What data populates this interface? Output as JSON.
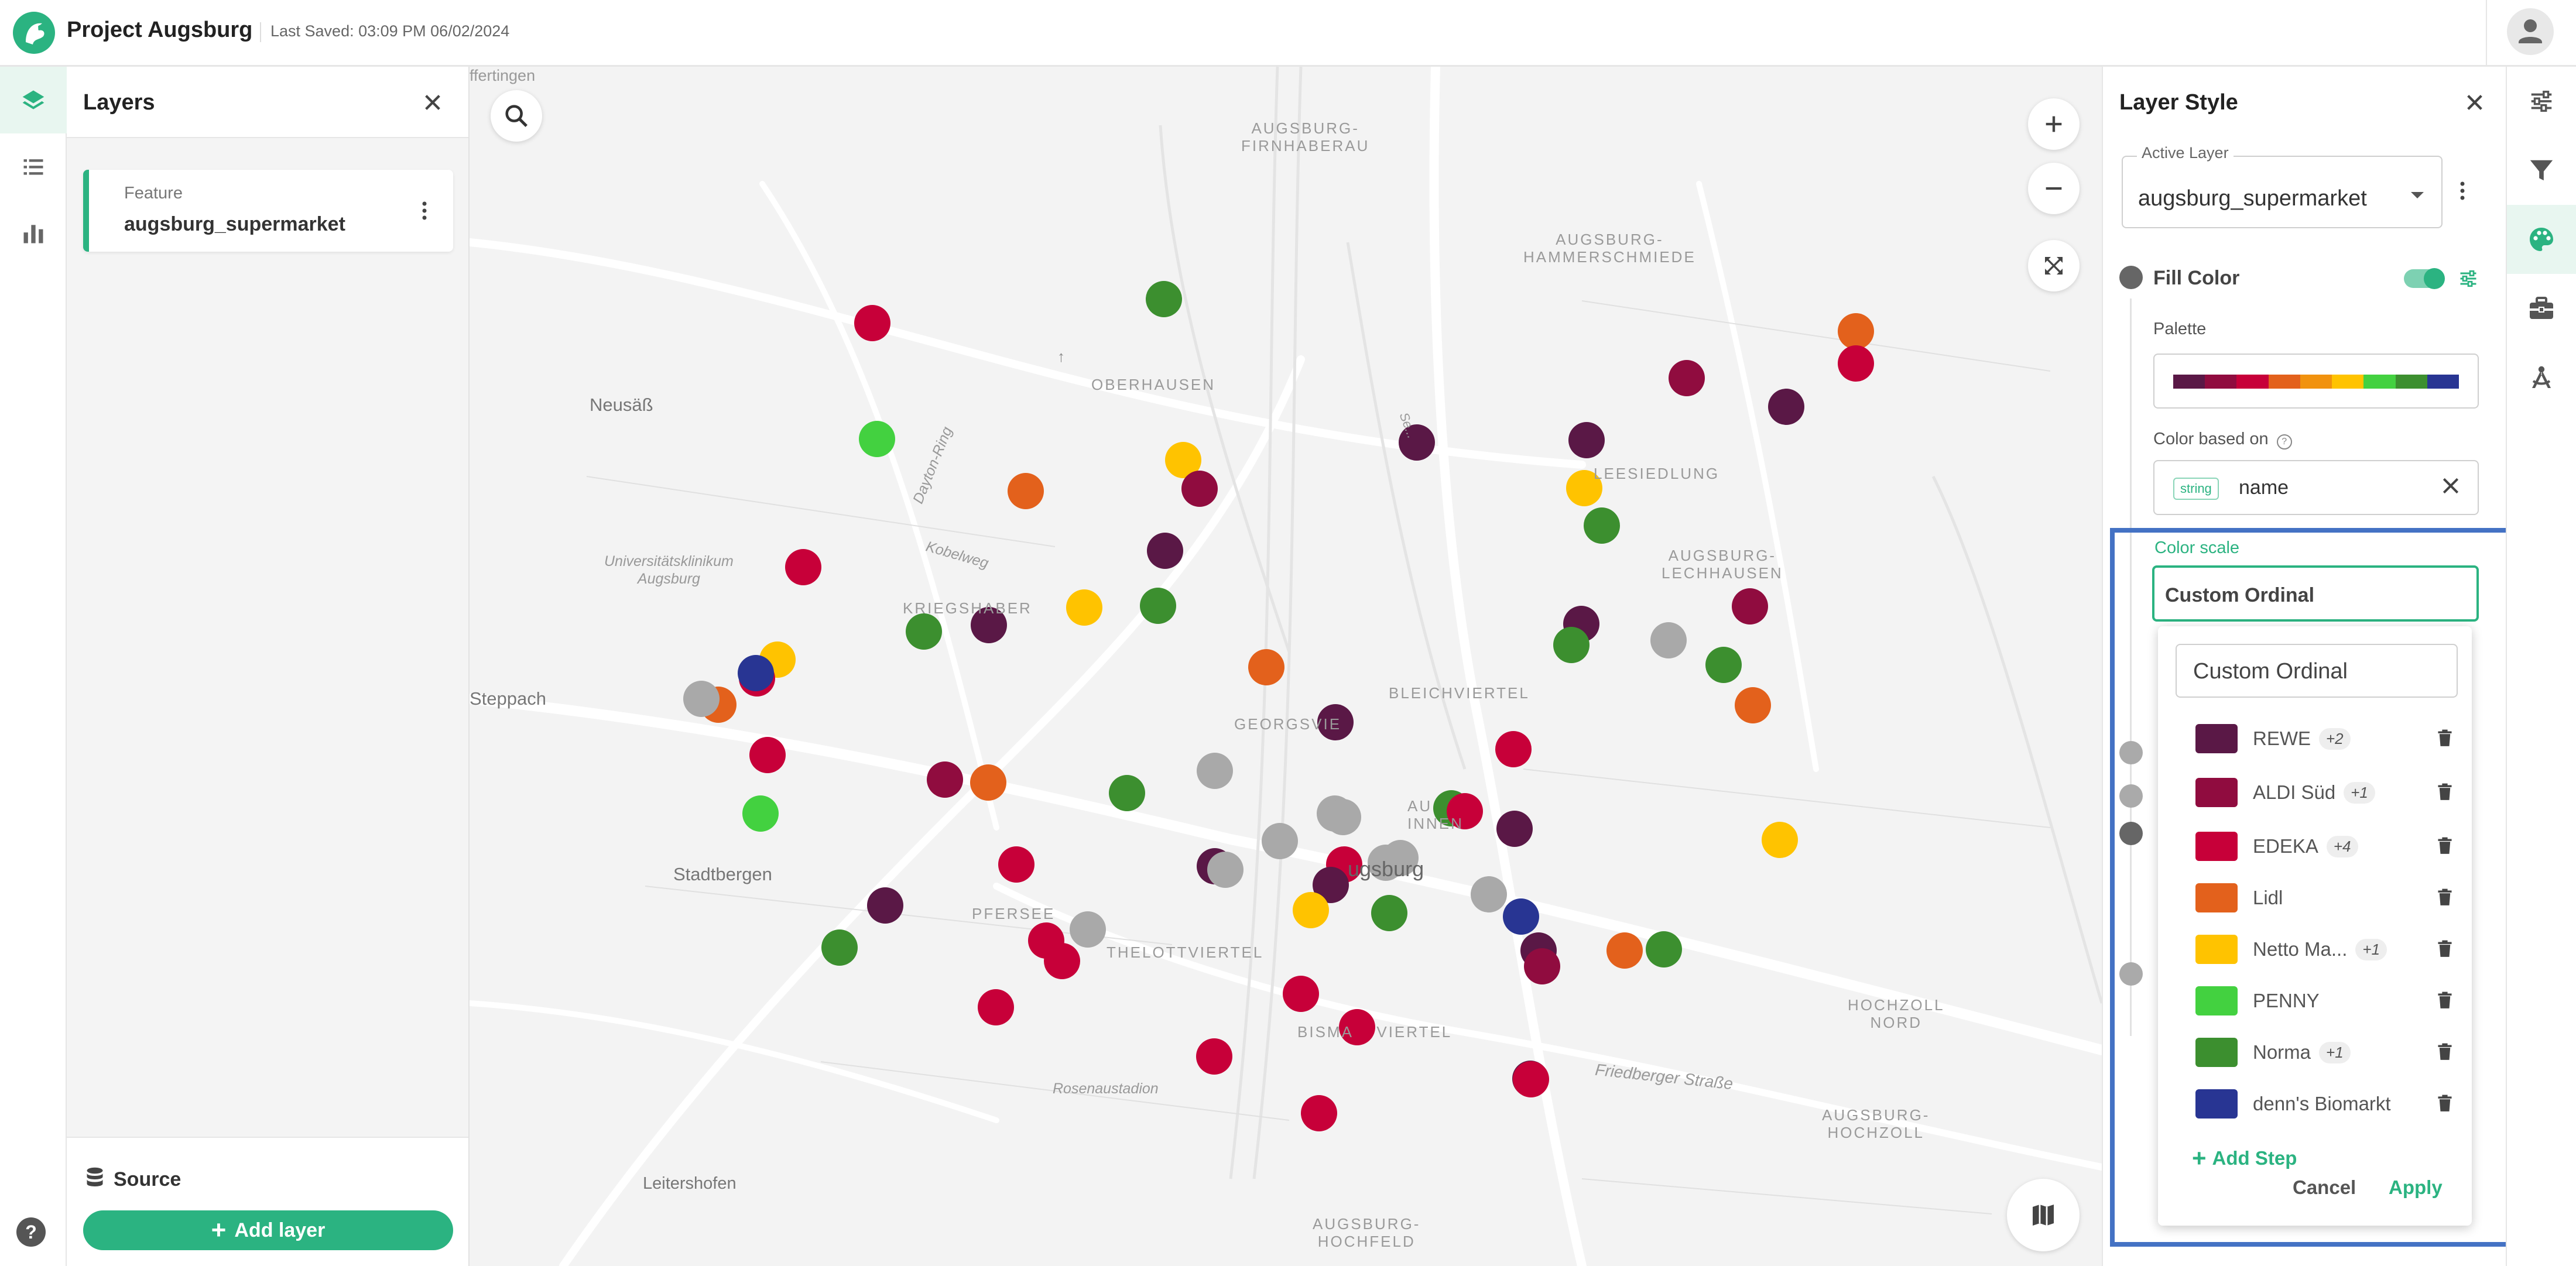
{
  "header": {
    "app_title": "Project Augsburg",
    "last_saved": "Last Saved: 03:09 PM 06/02/2024"
  },
  "left_rail": {
    "items": [
      {
        "icon": "layers-icon",
        "active": true
      },
      {
        "icon": "list-icon",
        "active": false
      },
      {
        "icon": "bar-chart-icon",
        "active": false
      }
    ]
  },
  "layers_panel": {
    "title": "Layers",
    "layer_card": {
      "type": "Feature",
      "name": "augsburg_supermarket"
    },
    "source_label": "Source",
    "add_layer_label": "Add layer"
  },
  "map": {
    "labels": {
      "affingen": "ffertingen",
      "neusass": "Neusäß",
      "steppach": "Steppach",
      "stadtbergen": "Stadtbergen",
      "leitershofen": "Leitershofen",
      "oberhausen": "OBERHAUSEN",
      "firnhaberau": "AUGSBURG-\nFIRNHABERAU",
      "hammerschmiede": "AUGSBURG-\nHAMMERSCHMIEDE",
      "lechhausen": "AUGSBURG-\nLECHHAUSEN",
      "kriegshaber": "KRIEGSHABER",
      "georgsviertel": "GEORGSVIE",
      "bleichviertel": "BLEICHVIERTEL",
      "pfersee": "PFERSEE",
      "thelottviertel": "THELOTTVIERTEL",
      "bismarckviertel": "BISMA    VIERTEL",
      "hochfeld": "AUGSBURG-\nHOCHFELD",
      "hochzoll_nord": "HOCHZOLL\nNORD",
      "hochzoll": "AUGSBURG-\nHOCHZOLL",
      "leesiedlung": "LEESIEDLUNG",
      "augsburg_center": "ugsburg",
      "innenstadt": "AU\nINNEN",
      "uniklinikum": "Universitätsklinikum\nAugsburg",
      "dayton_ring": "Dayton-Ring",
      "kobelweg": "Kobelweg",
      "rosenaustadion": "Rosenaustadion",
      "friedberger_strasse": "Friedberger Straße",
      "gruenweg": "Se...",
      "gersthofen_arrow": "↑"
    }
  },
  "style_panel": {
    "title": "Layer Style",
    "active_layer_label": "Active Layer",
    "active_layer_value": "augsburg_supermarket",
    "fill_color_label": "Fill Color",
    "fill_color_enabled": true,
    "palette_label": "Palette",
    "palette_colors": [
      "#5a1846",
      "#900c3f",
      "#c70039",
      "#e3611c",
      "#f1920e",
      "#ffc300",
      "#43d140",
      "#3c8f2f",
      "#283593"
    ],
    "color_based_on_label": "Color based on",
    "color_based_on_type": "string",
    "color_based_on_value": "name",
    "color_scale_label": "Color scale",
    "color_scale_value": "Custom Ordinal"
  },
  "scale_popup": {
    "search_value": "Custom Ordinal",
    "steps": [
      {
        "name": "REWE",
        "badge": "+2",
        "color": "#5a1846"
      },
      {
        "name": "ALDI Süd",
        "badge": "+1",
        "color": "#900c3f"
      },
      {
        "name": "EDEKA",
        "badge": "+4",
        "color": "#c70039"
      },
      {
        "name": "Lidl",
        "badge": "",
        "color": "#e3611c"
      },
      {
        "name": "Netto Ma...",
        "badge": "+1",
        "color": "#ffc300"
      },
      {
        "name": "PENNY",
        "badge": "",
        "color": "#43d140"
      },
      {
        "name": "Norma",
        "badge": "+1",
        "color": "#3c8f2f"
      },
      {
        "name": "denn's Biomarkt",
        "badge": "",
        "color": "#283593"
      }
    ],
    "add_step_label": "Add Step",
    "cancel_label": "Cancel",
    "apply_label": "Apply"
  },
  "right_rail": {
    "items": [
      {
        "icon": "sliders-icon",
        "active": false
      },
      {
        "icon": "filter-icon",
        "active": false
      },
      {
        "icon": "palette-icon",
        "active": true
      },
      {
        "icon": "toolbox-icon",
        "active": false
      },
      {
        "icon": "drafting-compass-icon",
        "active": false
      }
    ]
  },
  "colors": {
    "accent": "#2bb381",
    "highlight_frame": "#4472c4",
    "points_other": "#a9a9a9"
  }
}
